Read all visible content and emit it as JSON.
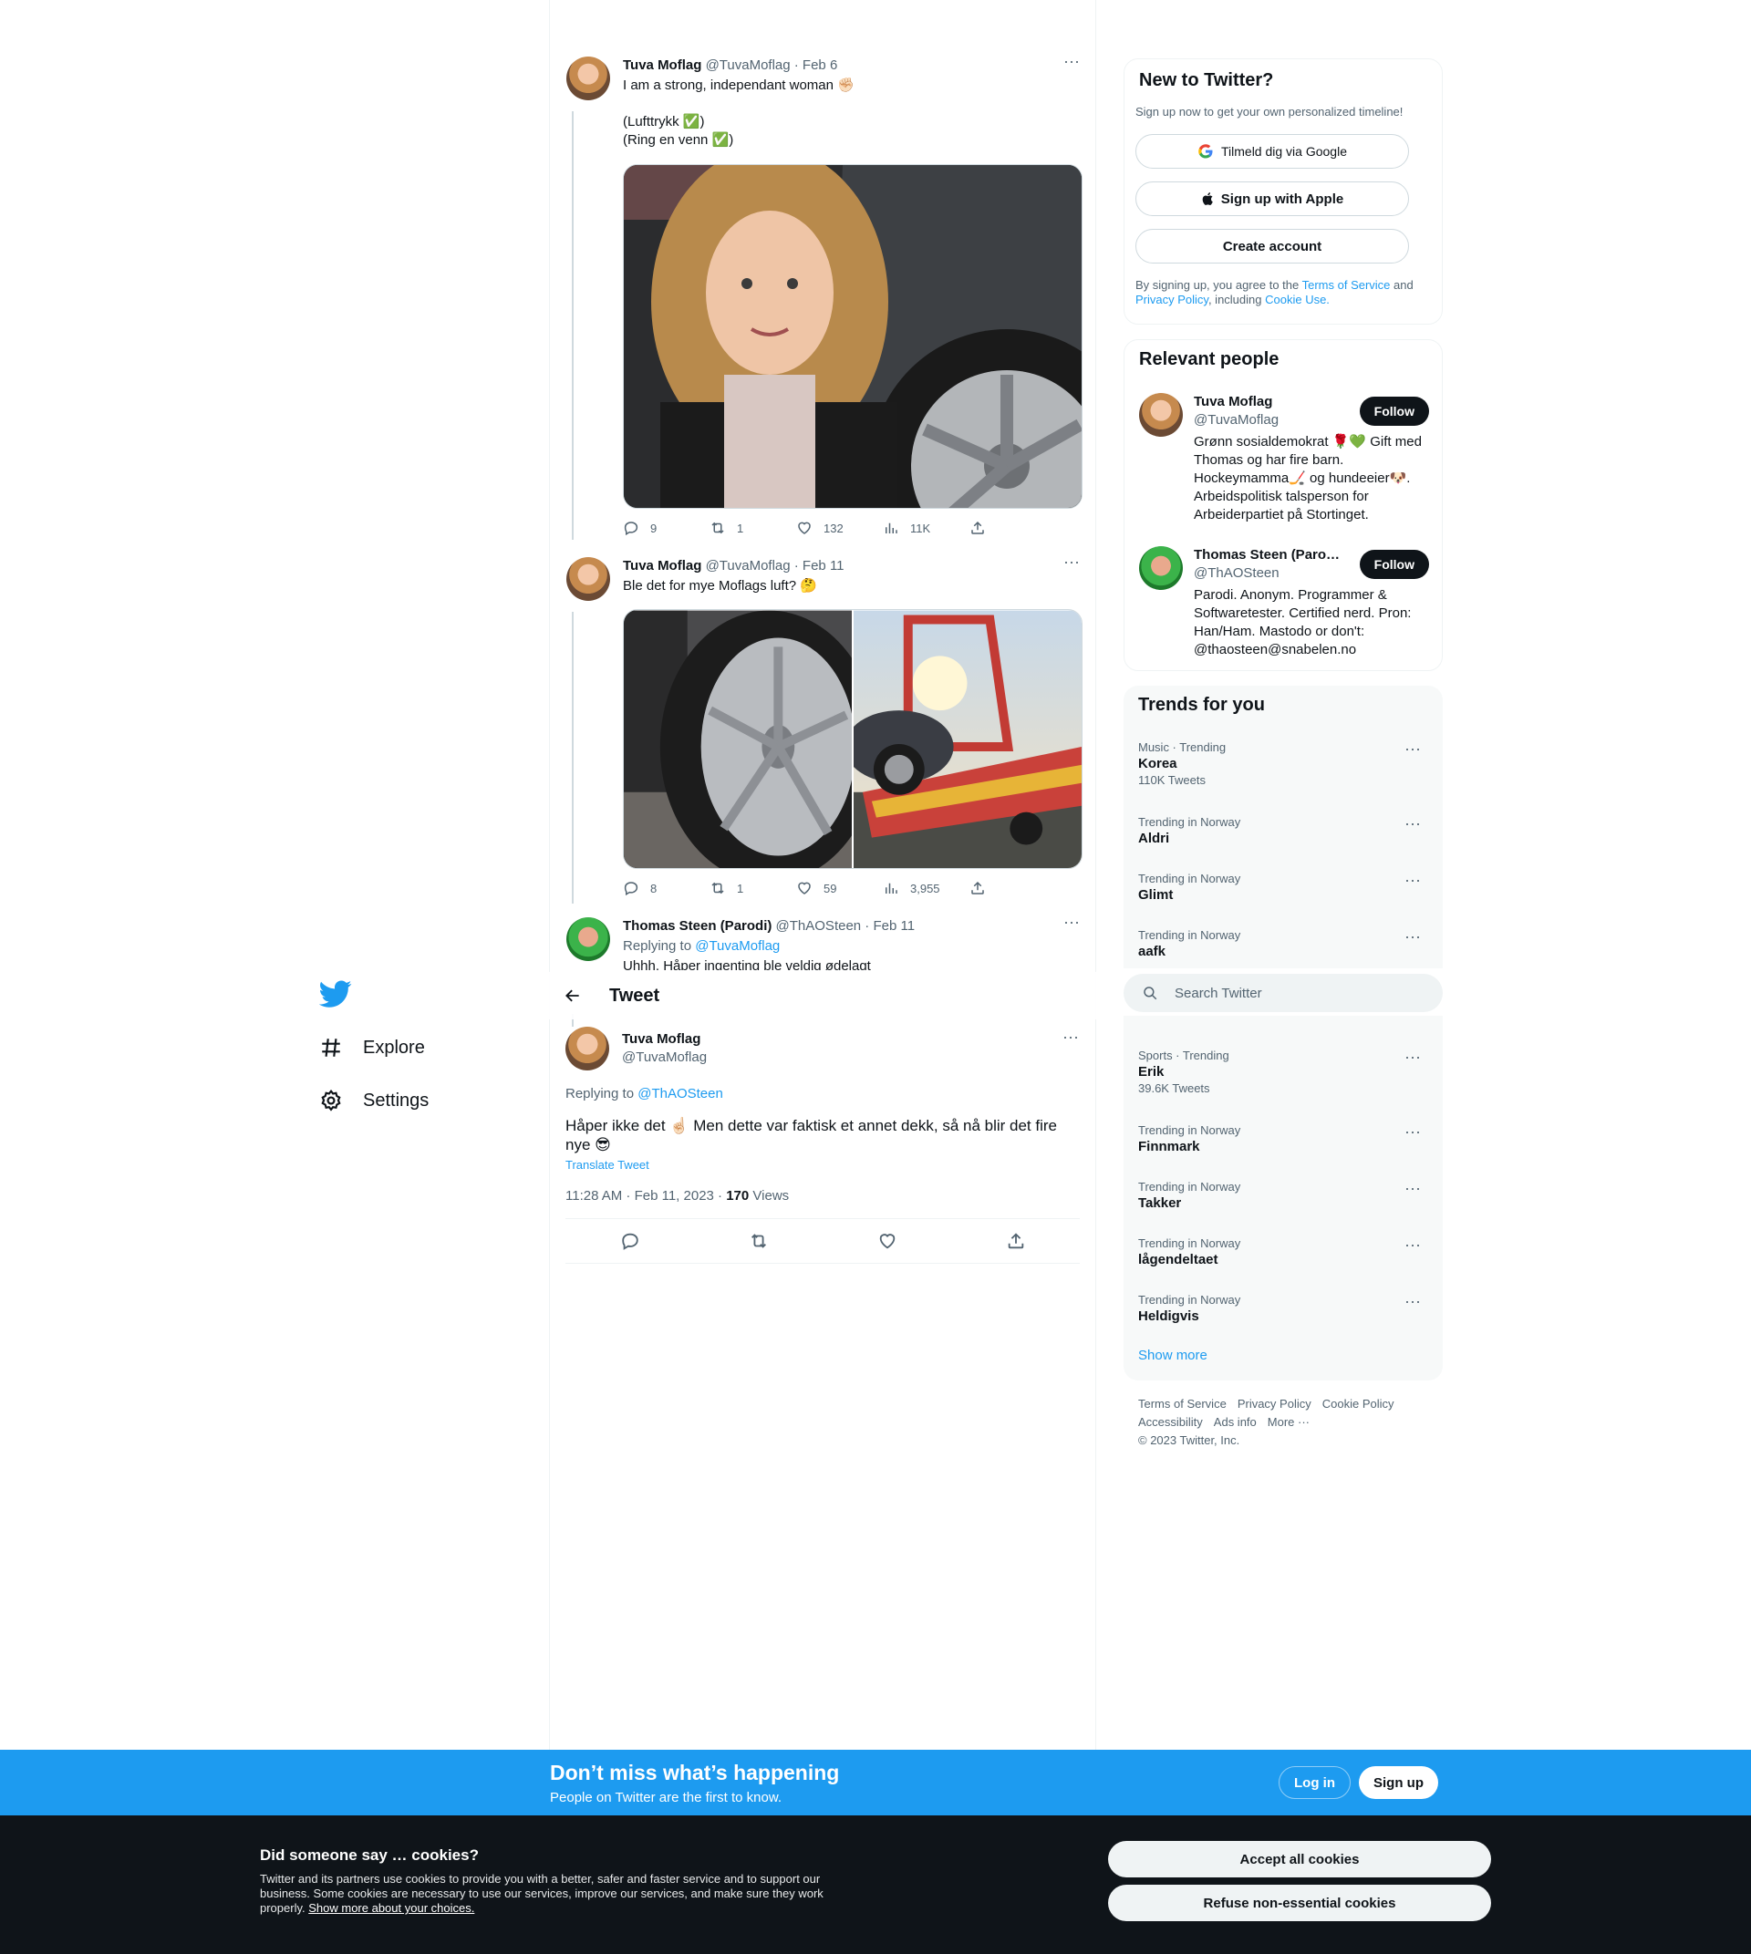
{
  "nav": {
    "explore": "Explore",
    "settings": "Settings"
  },
  "tweets": [
    {
      "name": "Tuva Moflag",
      "meta": "@TuvaMoflag · Feb 6",
      "text": "I am a strong, independant woman ✊🏻\n\n(Lufttrykk ✅)\n(Ring en venn ✅)",
      "replies": "9",
      "retweets": "1",
      "likes": "132",
      "views": "11K"
    },
    {
      "name": "Tuva Moflag",
      "meta": "@TuvaMoflag · Feb 11",
      "text": "Ble det for mye Moflags luft? 🤔",
      "replies": "8",
      "retweets": "1",
      "likes": "59",
      "views": "3,955"
    },
    {
      "name": "Thomas Steen (Parodi)",
      "meta": "@ThAOSteen · Feb 11",
      "replying_label": "Replying to",
      "replying_handle": "@TuvaMoflag",
      "text": "Uhhh. Håper ingenting ble veldig ødelagt"
    }
  ],
  "header": {
    "title": "Tweet"
  },
  "focus": {
    "name": "Tuva Moflag",
    "handle": "@TuvaMoflag",
    "replying_label": "Replying to",
    "replying_handle": "@ThAOSteen",
    "text": "Håper ikke det ☝🏻 Men dette var faktisk et annet dekk, så nå blir det fire nye 😎",
    "translate": "Translate Tweet",
    "time": "11:28 AM · Feb 11, 2023 · ",
    "views_count": "170",
    "views_label": " Views"
  },
  "signup": {
    "title": "New to Twitter?",
    "subtitle": "Sign up now to get your own personalized timeline!",
    "google": "Tilmeld dig via Google",
    "apple": "Sign up with Apple",
    "create": "Create account",
    "terms_pre": "By signing up, you agree to the ",
    "terms": "Terms of Service",
    "and": " and ",
    "privacy": "Privacy Policy",
    "including": ", including ",
    "cookie": "Cookie Use."
  },
  "people": {
    "title": "Relevant people",
    "follow": "Follow",
    "list": [
      {
        "name": "Tuva Moflag",
        "handle": "@TuvaMoflag",
        "bio": "Grønn sosialdemokrat 🌹💚 Gift med Thomas og har fire barn. Hockeymamma🏒 og hundeeier🐶. Arbeidspolitisk talsperson for Arbeiderpartiet på Stortinget."
      },
      {
        "name": "Thomas Steen (Paro…",
        "handle": "@ThAOSteen",
        "bio": "Parodi. Anonym. Programmer & Softwaretester. Certified nerd. Pron: Han/Ham. Mastodo or don't: @thaosteen@snabelen.no"
      }
    ]
  },
  "trends": {
    "title": "Trends for you",
    "items_top": [
      {
        "meta": "Music · Trending",
        "name": "Korea",
        "count": "110K Tweets"
      },
      {
        "meta": "Trending in Norway",
        "name": "Aldri",
        "count": ""
      },
      {
        "meta": "Trending in Norway",
        "name": "Glimt",
        "count": ""
      },
      {
        "meta": "Trending in Norway",
        "name": "aafk",
        "count": ""
      }
    ],
    "items_bottom": [
      {
        "meta": "Sports · Trending",
        "name": "Erik",
        "count": "39.6K Tweets"
      },
      {
        "meta": "Trending in Norway",
        "name": "Finnmark",
        "count": ""
      },
      {
        "meta": "Trending in Norway",
        "name": "Takker",
        "count": ""
      },
      {
        "meta": "Trending in Norway",
        "name": "lågendeltaet",
        "count": ""
      },
      {
        "meta": "Trending in Norway",
        "name": "Heldigvis",
        "count": ""
      }
    ],
    "show_more": "Show more"
  },
  "search": {
    "placeholder": "Search Twitter"
  },
  "footer": {
    "links": [
      "Terms of Service",
      "Privacy Policy",
      "Cookie Policy",
      "Accessibility",
      "Ads info",
      "More ···"
    ],
    "copyright": "© 2023 Twitter, Inc."
  },
  "bottombar": {
    "title": "Don’t miss what’s happening",
    "subtitle": "People on Twitter are the first to know.",
    "login": "Log in",
    "signup": "Sign up"
  },
  "cookies": {
    "title": "Did someone say … cookies?",
    "body": "Twitter and its partners use cookies to provide you with a better, safer and faster service and to support our business. Some cookies are necessary to use our services, improve our services, and make sure they work properly. ",
    "link": "Show more about your choices.",
    "accept": "Accept all cookies",
    "refuse": "Refuse non-essential cookies"
  },
  "colors": {
    "accent": "#1d9bf0",
    "text": "#0f1419",
    "secondary": "#536471"
  }
}
